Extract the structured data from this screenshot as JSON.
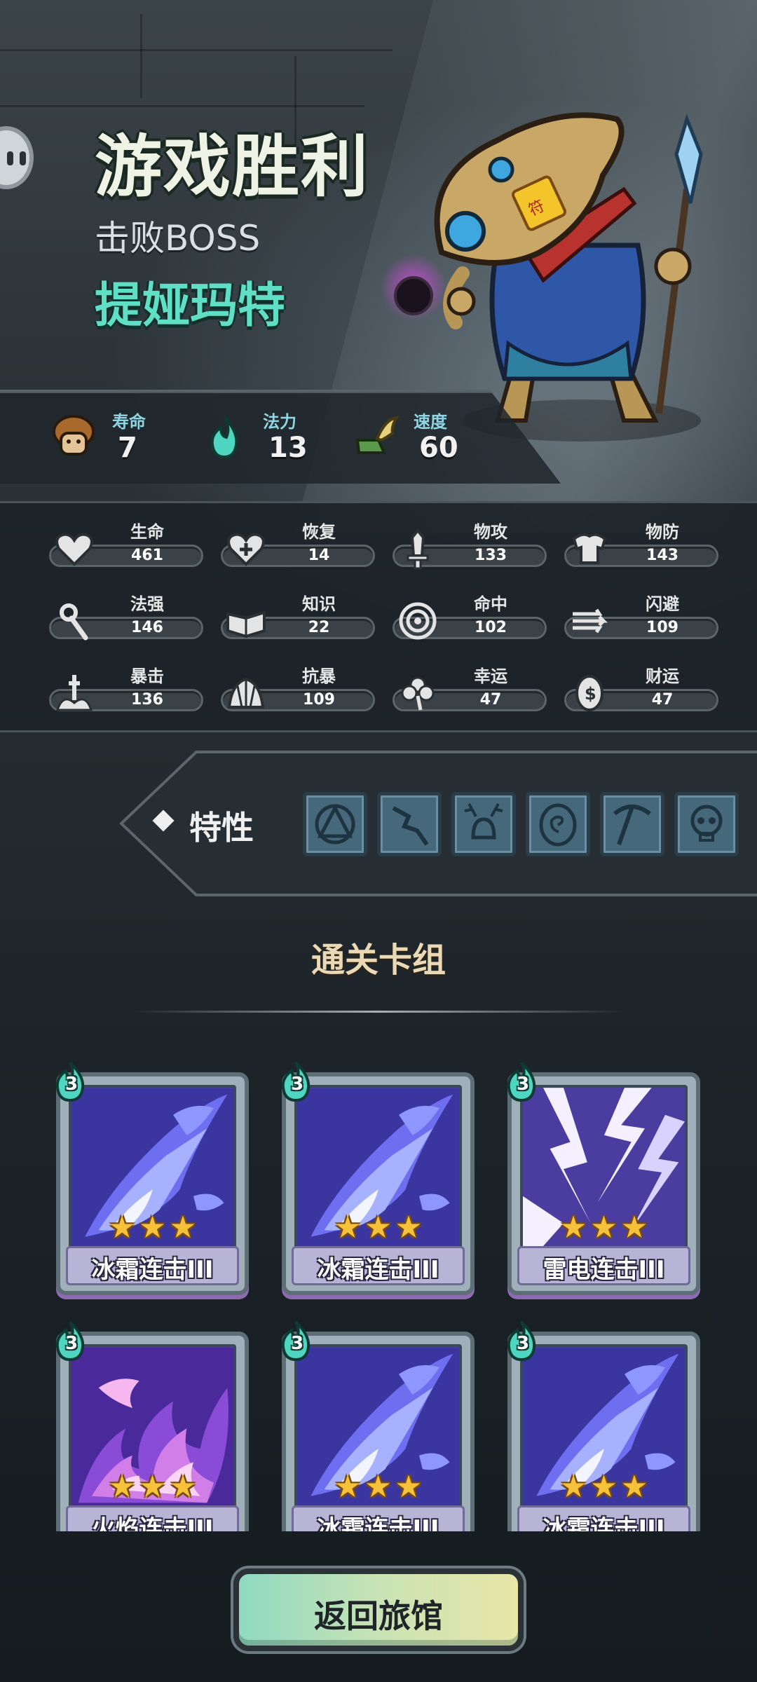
{
  "header": {
    "title": "游戏胜利",
    "subtitle": "击败BOSS",
    "boss_name": "提娅玛特"
  },
  "summary": [
    {
      "label": "寿命",
      "value": "7",
      "icon": "mushroom-hero-icon"
    },
    {
      "label": "法力",
      "value": "13",
      "icon": "mana-flame-icon"
    },
    {
      "label": "速度",
      "value": "60",
      "icon": "winged-boot-icon"
    }
  ],
  "stats": [
    {
      "label": "生命",
      "value": "461",
      "icon": "heart-icon"
    },
    {
      "label": "恢复",
      "value": "14",
      "icon": "heart-plus-icon"
    },
    {
      "label": "物攻",
      "value": "133",
      "icon": "sword-icon"
    },
    {
      "label": "物防",
      "value": "143",
      "icon": "armor-icon"
    },
    {
      "label": "法强",
      "value": "146",
      "icon": "staff-icon"
    },
    {
      "label": "知识",
      "value": "22",
      "icon": "book-icon"
    },
    {
      "label": "命中",
      "value": "102",
      "icon": "target-icon"
    },
    {
      "label": "闪避",
      "value": "109",
      "icon": "dodge-arrows-icon"
    },
    {
      "label": "暴击",
      "value": "136",
      "icon": "crit-icon"
    },
    {
      "label": "抗暴",
      "value": "109",
      "icon": "shell-icon"
    },
    {
      "label": "幸运",
      "value": "47",
      "icon": "clover-icon"
    },
    {
      "label": "财运",
      "value": "47",
      "icon": "coin-icon"
    }
  ],
  "traits": {
    "title": "特性",
    "slots": [
      "rune-triangle-icon",
      "cracked-staff-icon",
      "antler-bell-icon",
      "swirl-stone-icon",
      "pickaxe-icon",
      "skull-icon"
    ]
  },
  "deck": {
    "title": "通关卡组",
    "cards": [
      {
        "name": "冰霜连击III",
        "cost": "3",
        "stars": 3,
        "art": "frost"
      },
      {
        "name": "冰霜连击III",
        "cost": "3",
        "stars": 3,
        "art": "frost"
      },
      {
        "name": "雷电连击III",
        "cost": "3",
        "stars": 3,
        "art": "lightning"
      },
      {
        "name": "火焰连击III",
        "cost": "3",
        "stars": 3,
        "art": "flame"
      },
      {
        "name": "冰霜连击III",
        "cost": "3",
        "stars": 3,
        "art": "frost"
      },
      {
        "name": "冰霜连击III",
        "cost": "3",
        "stars": 3,
        "art": "frost"
      }
    ]
  },
  "buttons": {
    "return_label": "返回旅馆"
  },
  "colors": {
    "title": "#eef3e6",
    "boss_name": "#5fe0c6",
    "deck_title": "#ead9b4",
    "star": "#f6c23a"
  }
}
